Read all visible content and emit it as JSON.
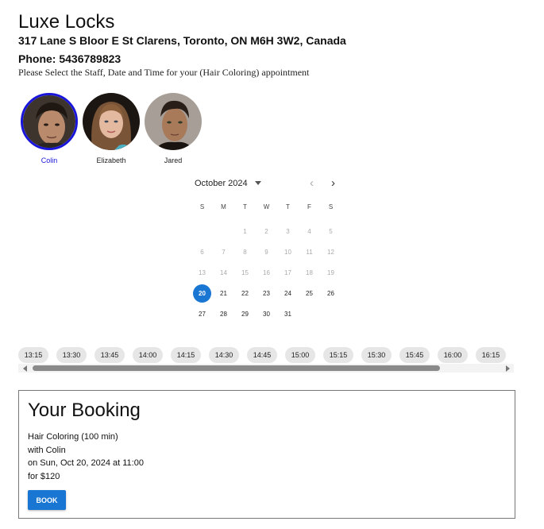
{
  "header": {
    "salon_name": "Luxe Locks",
    "address": "317 Lane S Bloor E St Clarens, Toronto, ON M6H 3W2, Canada",
    "phone": "Phone: 5436789823",
    "instructions": "Please Select the Staff, Date and Time for your (Hair Coloring) appointment"
  },
  "staff": [
    {
      "name": "Colin",
      "selected": true
    },
    {
      "name": "Elizabeth",
      "selected": false
    },
    {
      "name": "Jared",
      "selected": false
    }
  ],
  "calendar": {
    "month_label": "October 2024",
    "weekdays": [
      "S",
      "M",
      "T",
      "W",
      "T",
      "F",
      "S"
    ],
    "leading_blanks": 2,
    "days": [
      {
        "n": "1",
        "disabled": true
      },
      {
        "n": "2",
        "disabled": true
      },
      {
        "n": "3",
        "disabled": true
      },
      {
        "n": "4",
        "disabled": true
      },
      {
        "n": "5",
        "disabled": true
      },
      {
        "n": "6",
        "disabled": true
      },
      {
        "n": "7",
        "disabled": true
      },
      {
        "n": "8",
        "disabled": true
      },
      {
        "n": "9",
        "disabled": true
      },
      {
        "n": "10",
        "disabled": true
      },
      {
        "n": "11",
        "disabled": true
      },
      {
        "n": "12",
        "disabled": true
      },
      {
        "n": "13",
        "disabled": true
      },
      {
        "n": "14",
        "disabled": true
      },
      {
        "n": "15",
        "disabled": true
      },
      {
        "n": "16",
        "disabled": true
      },
      {
        "n": "17",
        "disabled": true
      },
      {
        "n": "18",
        "disabled": true
      },
      {
        "n": "19",
        "disabled": true
      },
      {
        "n": "20",
        "disabled": false,
        "selected": true
      },
      {
        "n": "21",
        "disabled": false
      },
      {
        "n": "22",
        "disabled": false
      },
      {
        "n": "23",
        "disabled": false
      },
      {
        "n": "24",
        "disabled": false
      },
      {
        "n": "25",
        "disabled": false
      },
      {
        "n": "26",
        "disabled": false
      },
      {
        "n": "27",
        "disabled": false
      },
      {
        "n": "28",
        "disabled": false
      },
      {
        "n": "29",
        "disabled": false
      },
      {
        "n": "30",
        "disabled": false
      },
      {
        "n": "31",
        "disabled": false
      }
    ],
    "selected_color": "#1976d2"
  },
  "time_slots": [
    "13:15",
    "13:30",
    "13:45",
    "14:00",
    "14:15",
    "14:30",
    "14:45",
    "15:00",
    "15:15",
    "15:30",
    "15:45",
    "16:00",
    "16:15"
  ],
  "booking": {
    "title": "Your Booking",
    "service": "Hair Coloring (100 min)",
    "staff": "with Colin",
    "datetime": "on Sun, Oct 20, 2024 at 11:00",
    "price": "for $120",
    "book_label": "BOOK"
  },
  "colors": {
    "accent": "#1976d2",
    "selected_staff": "#1a16d9"
  }
}
